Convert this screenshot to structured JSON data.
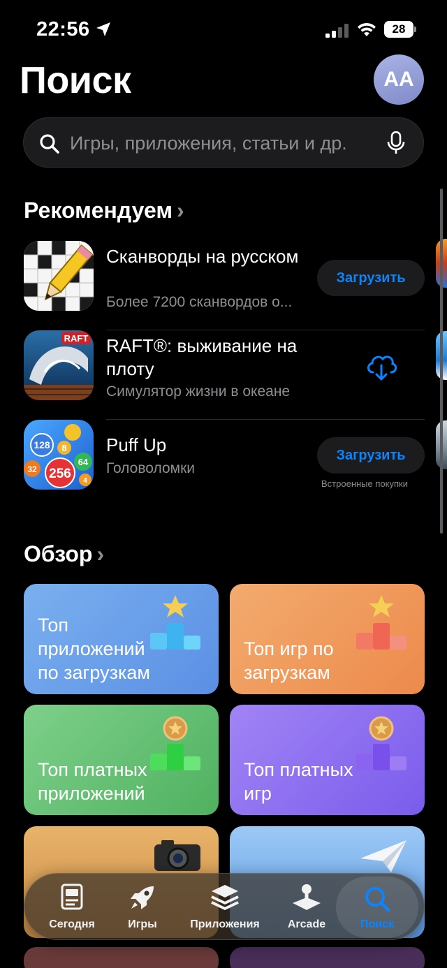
{
  "status_bar": {
    "time": "22:56",
    "battery": "28"
  },
  "header": {
    "title": "Поиск",
    "avatar_initials": "AA"
  },
  "search": {
    "placeholder": "Игры, приложения, статьи и др."
  },
  "recommended": {
    "title": "Рекомендуем",
    "apps": [
      {
        "name": "Сканворды на русском",
        "subtitle": "Более 7200 сканвордов о...",
        "action": "Загрузить",
        "icon": "crossword-pencil-icon"
      },
      {
        "name": "RAFT®: выживание на плоту",
        "subtitle": "Симулятор жизни в океане",
        "action": "cloud-download",
        "icon": "raft-shark-icon",
        "icon_text": "RAFT"
      },
      {
        "name": "Puff Up",
        "subtitle": "Головоломки",
        "action": "Загрузить",
        "note": "Встроенные покупки",
        "icon": "balls-2048-icon",
        "ball_numbers": [
          "128",
          "8",
          "64",
          "32",
          "256",
          "4"
        ]
      }
    ]
  },
  "browse": {
    "title": "Обзор",
    "tiles": [
      {
        "label": "Топ приложений по загрузкам",
        "color": "#6f9ee6"
      },
      {
        "label": "Топ игр по загрузкам",
        "color": "#ee9a5c"
      },
      {
        "label": "Топ платных приложений",
        "color": "#64c070"
      },
      {
        "label": "Топ платных игр",
        "color": "#8a6ff0"
      }
    ]
  },
  "tabbar": {
    "tabs": [
      {
        "label": "Сегодня",
        "icon": "today-icon"
      },
      {
        "label": "Игры",
        "icon": "rocket-icon"
      },
      {
        "label": "Приложения",
        "icon": "layers-icon"
      },
      {
        "label": "Arcade",
        "icon": "joystick-icon"
      },
      {
        "label": "Поиск",
        "icon": "search-icon",
        "active": true
      }
    ]
  },
  "colors": {
    "accent": "#0a84ff",
    "background": "#000000",
    "secondary_text": "#8e8e93"
  }
}
